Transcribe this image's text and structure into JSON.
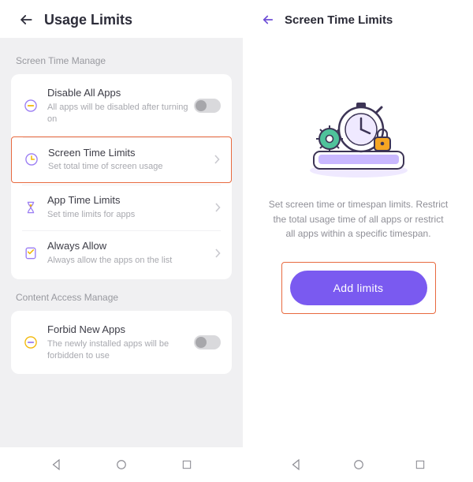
{
  "left": {
    "title": "Usage Limits",
    "section1": "Screen Time Manage",
    "section2": "Content Access Manage",
    "rows": {
      "disable": {
        "title": "Disable All Apps",
        "sub": "All apps will be disabled after turning on"
      },
      "screenTime": {
        "title": "Screen Time Limits",
        "sub": "Set total time of screen usage"
      },
      "appTime": {
        "title": "App Time Limits",
        "sub": "Set time limits for apps"
      },
      "always": {
        "title": "Always Allow",
        "sub": "Always allow the apps on the list"
      },
      "forbid": {
        "title": "Forbid New Apps",
        "sub": "The newly installed apps will be forbidden to use"
      }
    }
  },
  "right": {
    "title": "Screen Time Limits",
    "desc": "Set screen time or timespan limits. Restrict the total usage time of all apps or restrict all apps within a specific timespan.",
    "addBtn": "Add limits"
  }
}
